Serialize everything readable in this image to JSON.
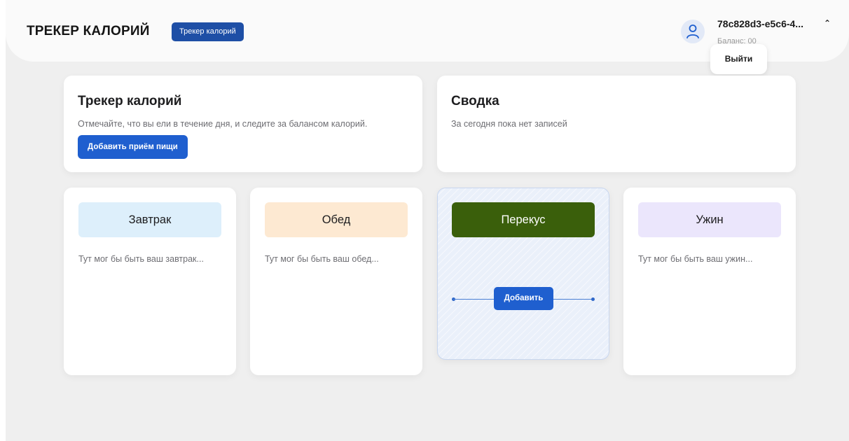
{
  "header": {
    "brand": "ТРЕКЕР КАЛОРИЙ",
    "badge": "Трекер калорий",
    "user": {
      "icon": "user-icon",
      "id": "78c828d3-e5c6-4...",
      "chevron": "⌃",
      "balance": "Баланс: 00",
      "logout_label": "Выйти"
    }
  },
  "intro": {
    "title": "Трекер калорий",
    "description": "Отмечайте, что вы ели в течение дня, и следите за балансом калорий.",
    "add_meal_label": "Добавить приём пищи"
  },
  "summary": {
    "title": "Сводка",
    "empty_text": "За сегодня пока нет записей"
  },
  "meals": [
    {
      "label": "Завтрак",
      "placeholder": "Тут мог бы быть ваш завтрак...",
      "color": "#ddeffb"
    },
    {
      "label": "Обед",
      "placeholder": "Тут мог бы быть ваш обед...",
      "color": "#fde9d2"
    },
    {
      "label": "Перекус",
      "add_label": "Добавить",
      "color": "#3a5f0b",
      "text_color": "#ffffff"
    },
    {
      "label": "Ужин",
      "placeholder": "Тут мог бы быть ваш ужин...",
      "color": "#ebe6fc"
    }
  ]
}
